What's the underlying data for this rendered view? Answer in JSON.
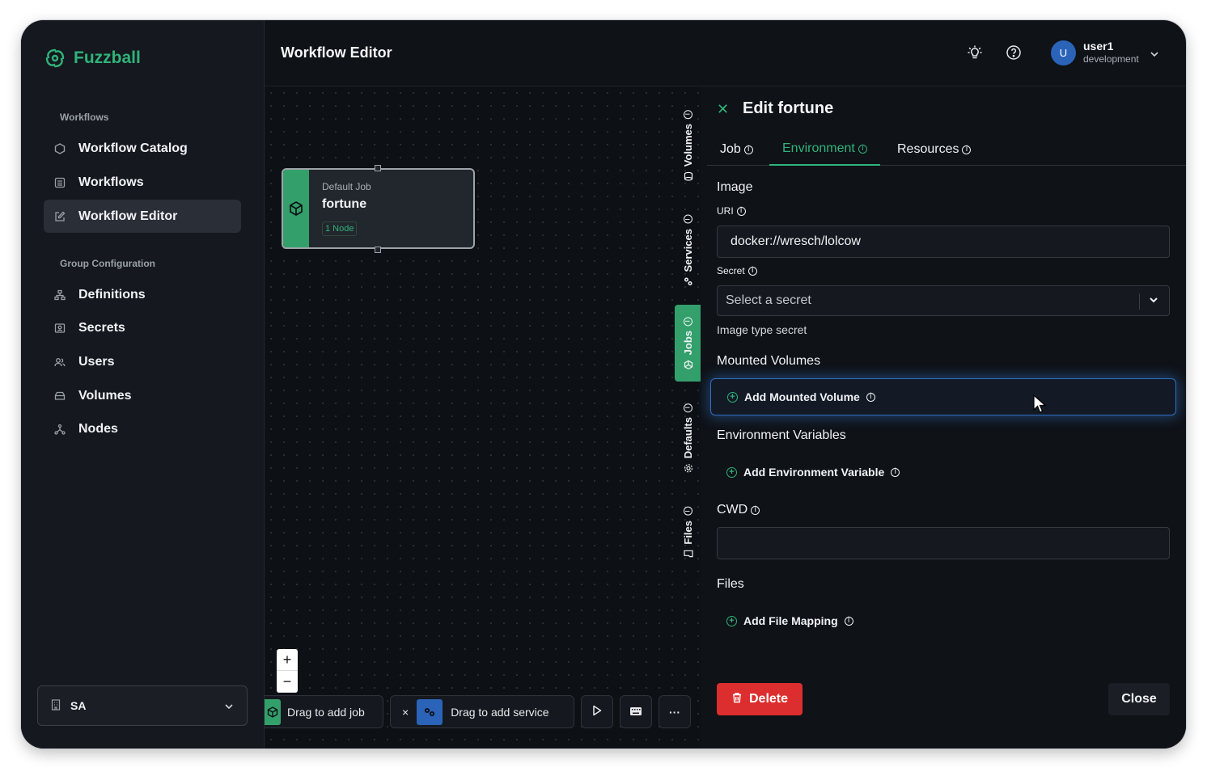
{
  "app": {
    "name": "Fuzzball"
  },
  "sidebar": {
    "sections": [
      {
        "title": "Workflows",
        "items": [
          {
            "label": "Workflow Catalog",
            "icon": "hexagon-icon",
            "active": false
          },
          {
            "label": "Workflows",
            "icon": "list-icon",
            "active": false
          },
          {
            "label": "Workflow Editor",
            "icon": "edit-icon",
            "active": true
          }
        ]
      },
      {
        "title": "Group Configuration",
        "items": [
          {
            "label": "Definitions",
            "icon": "hierarchy-icon",
            "active": false
          },
          {
            "label": "Secrets",
            "icon": "secret-icon",
            "active": false
          },
          {
            "label": "Users",
            "icon": "users-icon",
            "active": false
          },
          {
            "label": "Volumes",
            "icon": "volume-icon",
            "active": false
          },
          {
            "label": "Nodes",
            "icon": "nodes-icon",
            "active": false
          }
        ]
      }
    ],
    "org": {
      "label": "SA",
      "icon": "building-icon"
    }
  },
  "header": {
    "title": "Workflow Editor",
    "user": {
      "initial": "U",
      "name": "user1",
      "env": "development"
    }
  },
  "canvas": {
    "job_node": {
      "type": "Default Job",
      "name": "fortune",
      "badge": "1 Node"
    },
    "side_tabs": [
      "Volumes",
      "Services",
      "Jobs",
      "Defaults",
      "Files"
    ],
    "active_side_tab": "Jobs",
    "zoom": {
      "in": "+",
      "out": "−"
    },
    "toolbar": {
      "add_job": "Drag to add job",
      "add_service": "Drag to add service",
      "close": "×",
      "more": "···"
    }
  },
  "panel": {
    "title": "Edit fortune",
    "tabs": [
      "Job",
      "Environment",
      "Resources"
    ],
    "active_tab": "Environment",
    "image_heading": "Image",
    "uri_label": "URI",
    "uri_value": "docker://wresch/lolcow",
    "secret_label": "Secret",
    "secret_placeholder": "Select a secret",
    "secret_helper": "Image type secret",
    "mounted_volumes_heading": "Mounted Volumes",
    "add_mounted_volume": "Add Mounted Volume",
    "env_vars_heading": "Environment Variables",
    "add_env_var": "Add Environment Variable",
    "cwd_label": "CWD",
    "cwd_value": "",
    "files_heading": "Files",
    "add_file_mapping": "Add File Mapping",
    "delete_label": "Delete",
    "close_label": "Close"
  },
  "colors": {
    "accent": "#2fb37a",
    "danger": "#dc2e2e",
    "bg": "#0f1217",
    "highlight": "#2f6fbf"
  }
}
